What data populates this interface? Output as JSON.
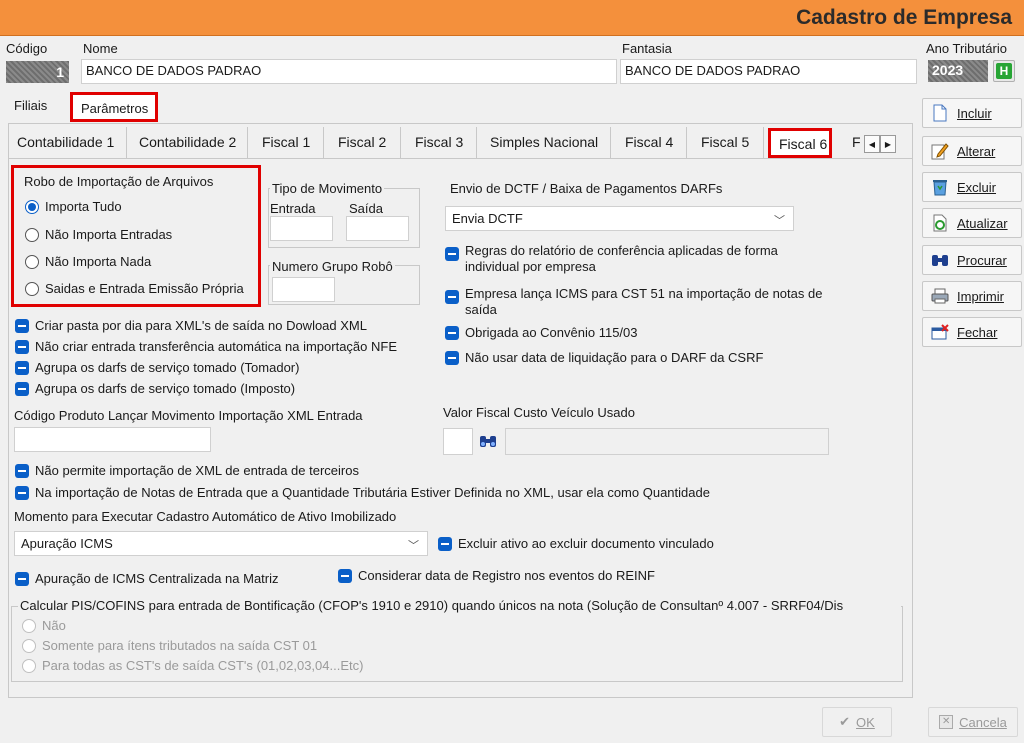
{
  "window": {
    "title": "Cadastro de Empresa"
  },
  "header": {
    "codigo_label": "Código",
    "codigo_value": "1",
    "nome_label": "Nome",
    "nome_value": "BANCO DE DADOS PADRAO",
    "fantasia_label": "Fantasia",
    "fantasia_value": "BANCO DE DADOS PADRAO",
    "ano_label": "Ano Tributário",
    "ano_value": "2023",
    "ano_button": "H"
  },
  "top_tabs": [
    "Filiais",
    "Parâmetros"
  ],
  "sub_tabs": [
    "Contabilidade 1",
    "Contabilidade 2",
    "Fiscal 1",
    "Fiscal 2",
    "Fiscal 3",
    "Simples Nacional",
    "Fiscal 4",
    "Fiscal 5",
    "Fiscal 6",
    "F"
  ],
  "robo": {
    "title": "Robo de Importação de Arquivos",
    "options": [
      "Importa Tudo",
      "Não Importa Entradas",
      "Não Importa Nada",
      "Saidas e Entrada Emissão Própria"
    ],
    "selected": "Importa Tudo"
  },
  "tipo_mov": {
    "title": "Tipo de Movimento",
    "entrada": "Entrada",
    "saida": "Saída"
  },
  "numero_grupo": "Numero Grupo Robô",
  "dctf": {
    "label": "Envio de DCTF / Baixa de Pagamentos DARFs",
    "value": "Envia DCTF"
  },
  "right_checks": [
    "Regras do relatório de  conferência aplicadas de forma individual por empresa",
    "Empresa lança ICMS para CST 51 na importação de notas de saída",
    "Obrigada ao Convênio 115/03",
    "Não usar data de liquidação para o DARF da CSRF"
  ],
  "left_checks": [
    "Criar pasta por dia para XML's de saída no Dowload XML",
    "Não criar entrada transferência automática na importação NFE",
    "Agrupa os darfs de serviço tomado (Tomador)",
    "Agrupa os darfs de serviço tomado (Imposto)"
  ],
  "codigo_produto_label": "Código Produto Lançar Movimento Importação XML Entrada",
  "valor_fiscal_label": "Valor Fiscal Custo Veículo Usado",
  "checks_mid": [
    "Não permite importação de XML de entrada de terceiros",
    "Na importação de Notas de Entrada que a Quantidade Tributária Estiver Definida no XML, usar  ela como Quantidade"
  ],
  "momento": {
    "label": "Momento para Executar Cadastro Automático de Ativo Imobilizado",
    "value": "Apuração ICMS"
  },
  "excluir_ativo": "Excluir ativo ao excluir documento vinculado",
  "apuracao_icms": "Apuração de ICMS Centralizada na Matriz",
  "considerar_reinf": "Considerar data de Registro nos eventos do REINF",
  "pis_cofins": {
    "title": "Calcular PIS/COFINS para entrada de Bontificação (CFOP's 1910 e 2910) quando únicos na nota (Solução de Consultanº 4.007 - SRRF04/Dis",
    "options": [
      "Não",
      "Somente para ítens tributados na saída CST 01",
      "Para todas as CST's de saída CST's (01,02,03,04...Etc)"
    ]
  },
  "side_buttons": [
    {
      "label": "Incluir",
      "icon": "document-icon"
    },
    {
      "label": "Alterar",
      "icon": "edit-icon"
    },
    {
      "label": "Excluir",
      "icon": "recycle-bin-icon"
    },
    {
      "label": "Atualizar",
      "icon": "refresh-icon"
    },
    {
      "label": "Procurar",
      "icon": "binoculars-icon"
    },
    {
      "label": "Imprimir",
      "icon": "printer-icon"
    },
    {
      "label": "Fechar",
      "icon": "close-window-icon"
    }
  ],
  "footer": {
    "ok": "OK",
    "cancel": "Cancela"
  },
  "colors": {
    "titlebar": "#f4903c",
    "accent": "#0a5fc8",
    "highlight": "#e00000"
  }
}
